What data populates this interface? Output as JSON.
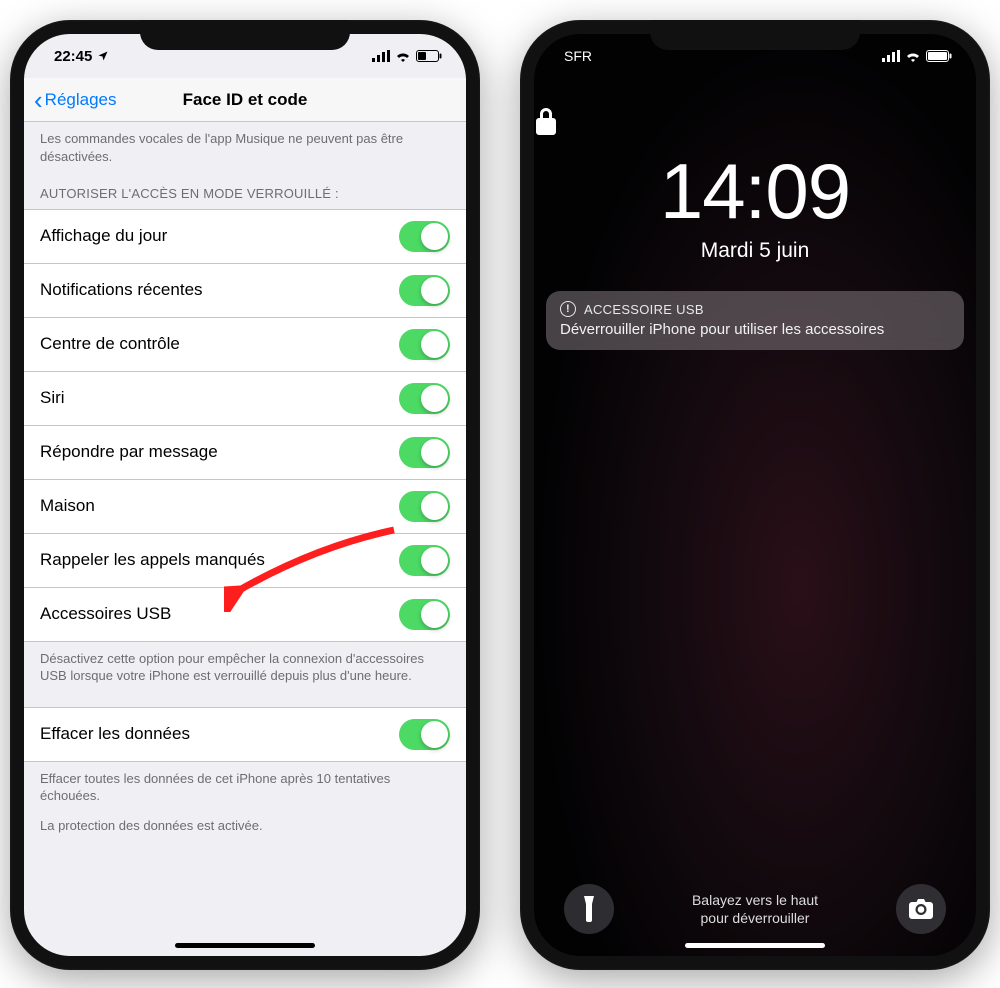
{
  "left": {
    "status": {
      "time": "22:45",
      "carrier_icons": "nav-wifi-batt"
    },
    "nav": {
      "back": "Réglages",
      "title": "Face ID et code"
    },
    "intro_footer": "Les commandes vocales de l'app Musique ne peuvent pas être désactivées.",
    "section_header": "AUTORISER L'ACCÈS EN MODE VERROUILLÉ :",
    "rows": [
      {
        "label": "Affichage du jour",
        "on": true
      },
      {
        "label": "Notifications récentes",
        "on": true
      },
      {
        "label": "Centre de contrôle",
        "on": true
      },
      {
        "label": "Siri",
        "on": true
      },
      {
        "label": "Répondre par message",
        "on": true
      },
      {
        "label": "Maison",
        "on": true
      },
      {
        "label": "Rappeler les appels manqués",
        "on": true
      },
      {
        "label": "Accessoires USB",
        "on": true
      }
    ],
    "section_footer": "Désactivez cette option pour empêcher la connexion d'accessoires USB lorsque votre iPhone est verrouillé depuis plus d'une heure.",
    "erase": {
      "label": "Effacer les données",
      "on": true
    },
    "erase_footer1": "Effacer toutes les données de cet iPhone après 10 tentatives échouées.",
    "erase_footer2": "La protection des données est activée."
  },
  "right": {
    "status": {
      "carrier": "SFR"
    },
    "time": "14:09",
    "date": "Mardi 5 juin",
    "notif": {
      "title": "ACCESSOIRE USB",
      "body": "Déverrouiller iPhone pour utiliser les accessoires"
    },
    "hint1": "Balayez vers le haut",
    "hint2": "pour déverrouiller"
  },
  "colors": {
    "ios_blue": "#007aff",
    "toggle_green": "#4cd964",
    "arrow_red": "#ff1e1e"
  }
}
